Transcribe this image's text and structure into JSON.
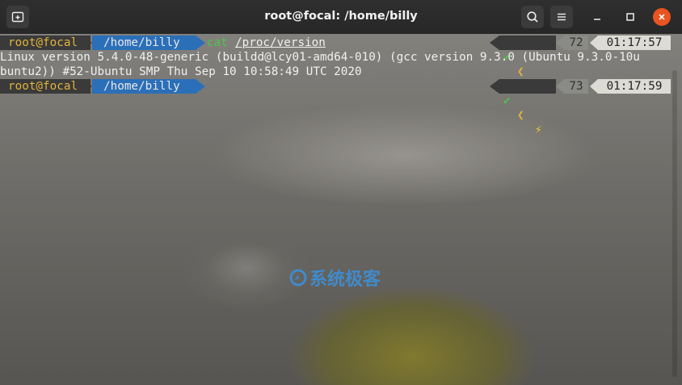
{
  "window": {
    "title": "root@focal: /home/billy"
  },
  "prompt1": {
    "user": "root@focal",
    "dir": "/home/billy",
    "cmd": "cat",
    "arg": "/proc/version",
    "count": "72",
    "time": "01:17:57"
  },
  "output": {
    "line1": "Linux version 5.4.0-48-generic (buildd@lcy01-amd64-010) (gcc version 9.3.0 (Ubuntu 9.3.0-10u",
    "line2": "buntu2)) #52-Ubuntu SMP Thu Sep 10 10:58:49 UTC 2020"
  },
  "prompt2": {
    "user": "root@focal",
    "dir": "/home/billy",
    "count": "73",
    "time": "01:17:59"
  },
  "watermark": {
    "text": "系统极客"
  },
  "icons": {
    "new_tab": "new-tab-icon",
    "search": "search-icon",
    "menu": "hamburger-menu-icon",
    "minimize": "minimize-icon",
    "maximize": "maximize-icon",
    "close": "close-icon",
    "status_ok": "checkmark-icon",
    "lightning": "lightning-icon"
  },
  "colors": {
    "dir_bg": "#2b6fb8",
    "user_fg": "#e3b33b",
    "cmd_fg": "#4ec44b",
    "close_bg": "#e95420"
  }
}
